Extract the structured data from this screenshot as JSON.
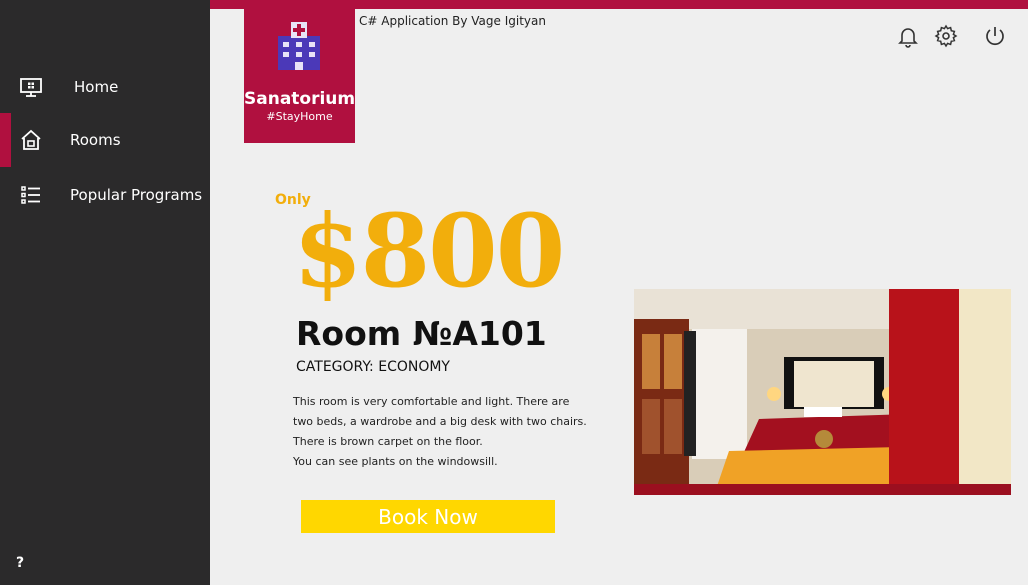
{
  "app": {
    "credit": "C# Application By Vage Igityan",
    "brand": "Sanatorium",
    "tagline": "#StayHome"
  },
  "sidebar": {
    "items": [
      {
        "label": "Home",
        "icon": "monitor-icon",
        "active": false
      },
      {
        "label": "Rooms",
        "icon": "house-icon",
        "active": true
      },
      {
        "label": "Popular Programs",
        "icon": "list-icon",
        "active": false
      }
    ],
    "help_label": "?"
  },
  "header": {
    "icons": [
      "bell-icon",
      "gear-icon",
      "power-icon"
    ]
  },
  "room": {
    "promo": "Only",
    "price": "$800",
    "title": "Room №A101",
    "category": "CATEGORY: ECONOMY",
    "description": [
      "This room is very comfortable and light. There are",
      "two beds, a wardrobe and a big desk with two chairs.",
      "There is brown carpet on the floor.",
      "You can see plants on the windowsill."
    ],
    "book_label": "Book Now"
  },
  "colors": {
    "accent": "#b0103f",
    "sidebar": "#2b2a2b",
    "price": "#f2ae0c",
    "button": "#ffd700",
    "background": "#efefef"
  }
}
